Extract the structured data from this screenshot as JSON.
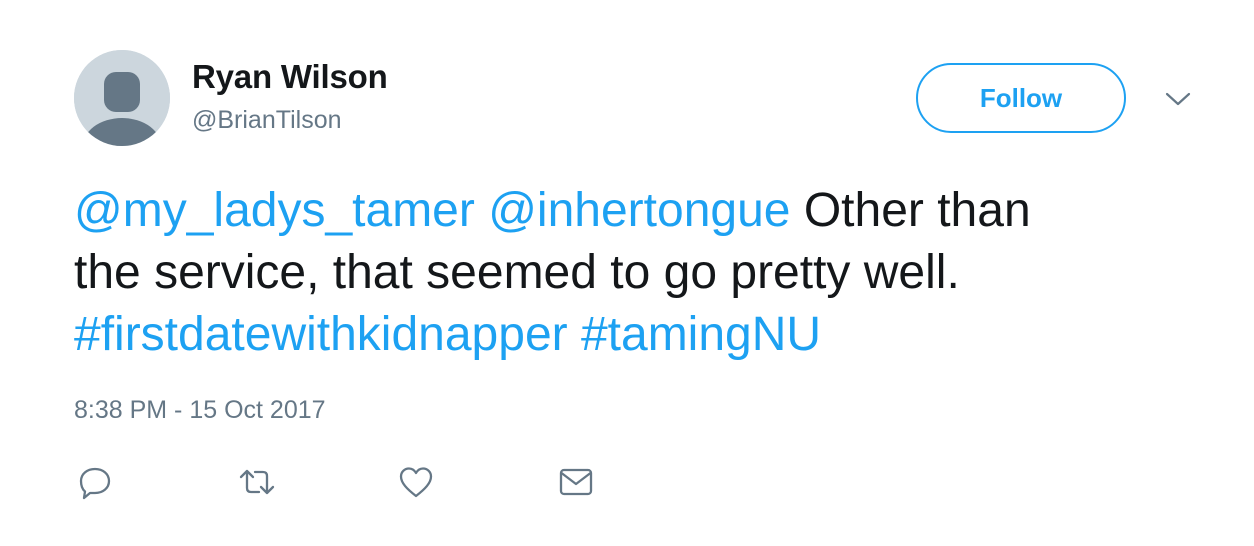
{
  "user": {
    "name": "Ryan Wilson",
    "handle": "@BrianTilson"
  },
  "follow_button": {
    "label": "Follow"
  },
  "tweet": {
    "line1": {
      "mention1": "@my_ladys_tamer",
      "mention2": "@inhertongue",
      "text": "Other than"
    },
    "line2": {
      "text": "the service, that seemed to go pretty well."
    },
    "line3": {
      "hashtag1": "#firstdatewithkidnapper",
      "hashtag2": "#tamingNU"
    }
  },
  "timestamp": "8:38 PM - 15 Oct 2017",
  "icons": {
    "avatar": "default-avatar-icon",
    "menu": "chevron-down-icon",
    "reply": "reply-icon",
    "retweet": "retweet-icon",
    "like": "heart-icon",
    "message": "envelope-icon"
  },
  "colors": {
    "accent": "#1da1f2",
    "text": "#14171a",
    "secondary_text": "#657786",
    "avatar_bg": "#ccd6dd",
    "avatar_fg": "#657786"
  }
}
